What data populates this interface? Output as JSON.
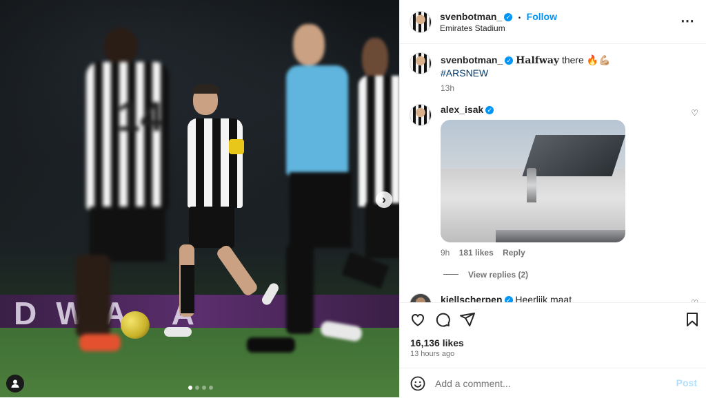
{
  "post": {
    "author": "svenbotman_",
    "location": "Emirates Stadium",
    "follow_label": "Follow",
    "dot_separator": "•",
    "caption_word": "𝐇𝐚𝐥𝐟𝐰𝐚𝐲",
    "caption_rest": "there 🔥💪🏼",
    "hashtag": "#ARSNEW",
    "caption_age": "13h",
    "likes": "16,136 likes",
    "posted": "13 hours ago",
    "carousel": {
      "slide_count": 4,
      "active_index": 0
    },
    "pitch_board_text": "DWA A",
    "shirt_number": "14"
  },
  "comments": [
    {
      "user": "alex_isak",
      "verified": true,
      "has_image": true,
      "age": "9h",
      "likes": "181 likes",
      "reply_label": "Reply",
      "view_replies": "View replies (2)"
    },
    {
      "user": "kjellscherpen",
      "verified": true,
      "text": "Heerlijk maat"
    }
  ],
  "add_comment": {
    "placeholder": "Add a comment...",
    "post_label": "Post"
  },
  "icons": {
    "more": "⋯",
    "next": "›",
    "heart": "♡",
    "verified": "✓"
  },
  "colors": {
    "accent": "#0095f6",
    "hashtag": "#00376b",
    "post_disabled": "#b2dffc"
  }
}
